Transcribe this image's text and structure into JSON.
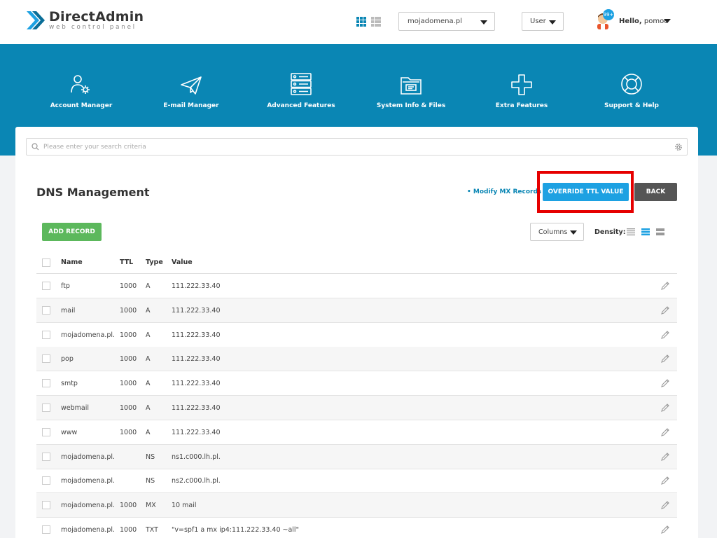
{
  "header": {
    "logo_title": "DirectAdmin",
    "logo_sub": "web control panel",
    "domain": "mojadomena.pl",
    "user_level": "User",
    "notifications": "99+",
    "greeting": "Hello,",
    "username": "pomoc"
  },
  "nav": [
    {
      "label": "Account Manager",
      "icon": "account-manager-icon"
    },
    {
      "label": "E-mail Manager",
      "icon": "paper-plane-icon"
    },
    {
      "label": "Advanced Features",
      "icon": "server-icon"
    },
    {
      "label": "System Info & Files",
      "icon": "folder-icon"
    },
    {
      "label": "Extra Features",
      "icon": "plus-icon"
    },
    {
      "label": "Support & Help",
      "icon": "lifebuoy-icon"
    }
  ],
  "search": {
    "placeholder": "Please enter your search criteria"
  },
  "page": {
    "title": "DNS Management",
    "mx_link": "• Modify MX Records",
    "override_label": "OVERRIDE TTL VALUE",
    "back_label": "BACK",
    "add_label": "ADD RECORD",
    "columns_label": "Columns",
    "density_label": "Density:"
  },
  "table": {
    "headers": {
      "name": "Name",
      "ttl": "TTL",
      "type": "Type",
      "value": "Value"
    },
    "rows": [
      {
        "name": "ftp",
        "ttl": "1000",
        "type": "A",
        "value": "111.222.33.40"
      },
      {
        "name": "mail",
        "ttl": "1000",
        "type": "A",
        "value": "111.222.33.40"
      },
      {
        "name": "mojadomena.pl.",
        "ttl": "1000",
        "type": "A",
        "value": "111.222.33.40"
      },
      {
        "name": "pop",
        "ttl": "1000",
        "type": "A",
        "value": "111.222.33.40"
      },
      {
        "name": "smtp",
        "ttl": "1000",
        "type": "A",
        "value": "111.222.33.40"
      },
      {
        "name": "webmail",
        "ttl": "1000",
        "type": "A",
        "value": "111.222.33.40"
      },
      {
        "name": "www",
        "ttl": "1000",
        "type": "A",
        "value": "111.222.33.40"
      },
      {
        "name": "mojadomena.pl.",
        "ttl": "",
        "type": "NS",
        "value": "ns1.c000.lh.pl."
      },
      {
        "name": "mojadomena.pl.",
        "ttl": "",
        "type": "NS",
        "value": "ns2.c000.lh.pl."
      },
      {
        "name": "mojadomena.pl.",
        "ttl": "1000",
        "type": "MX",
        "value": "10 mail"
      },
      {
        "name": "mojadomena.pl.",
        "ttl": "1000",
        "type": "TXT",
        "value": "\"v=spf1 a mx ip4:111.222.33.40 ~all\""
      }
    ]
  },
  "colors": {
    "brand_blue": "#0a86b4",
    "accent": "#1da1e2",
    "success": "#5cb85c",
    "highlight": "#e60000"
  }
}
